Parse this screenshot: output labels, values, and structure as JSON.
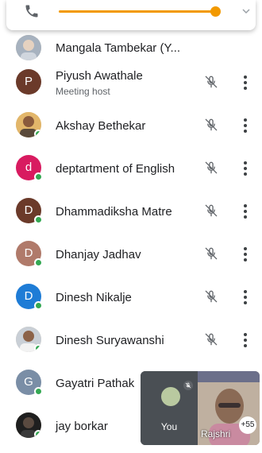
{
  "call_bar": {
    "phone_icon": "phone-icon",
    "volume_level": 0.88,
    "chevron_icon": "chevron-down-icon",
    "accent_color": "#f29900"
  },
  "participants": [
    {
      "name": "Mangala Tambekar (Y...",
      "avatar_type": "photo",
      "online": true
    },
    {
      "name": "Piyush Awathale",
      "subtitle": "Meeting host",
      "initial": "P",
      "avatar_color": "#6b3a2a",
      "online": false
    },
    {
      "name": "Akshay Bethekar",
      "avatar_type": "photo",
      "online": true
    },
    {
      "name": "deptartment of English",
      "initial": "d",
      "avatar_color": "#d81b60",
      "online": true
    },
    {
      "name": "Dhammadiksha Matre",
      "initial": "D",
      "avatar_color": "#6b3a2a",
      "online": true
    },
    {
      "name": "Dhanjay Jadhav",
      "initial": "D",
      "avatar_color": "#b07a6a",
      "online": true
    },
    {
      "name": "Dinesh Nikalje",
      "initial": "D",
      "avatar_color": "#1e7cd6",
      "online": true
    },
    {
      "name": "Dinesh Suryawanshi",
      "avatar_type": "photo",
      "online": true
    },
    {
      "name": "Gayatri Pathak",
      "initial": "G",
      "avatar_color": "#7a8ea6",
      "online": true
    },
    {
      "name": "jay borkar",
      "avatar_type": "photo",
      "online": true
    }
  ],
  "row_icons": {
    "mute": "mic-off-icon",
    "more": "more-vert-icon"
  },
  "pip": {
    "self_label": "You",
    "remote_label": "Rajshri",
    "participant_count": "+55"
  }
}
